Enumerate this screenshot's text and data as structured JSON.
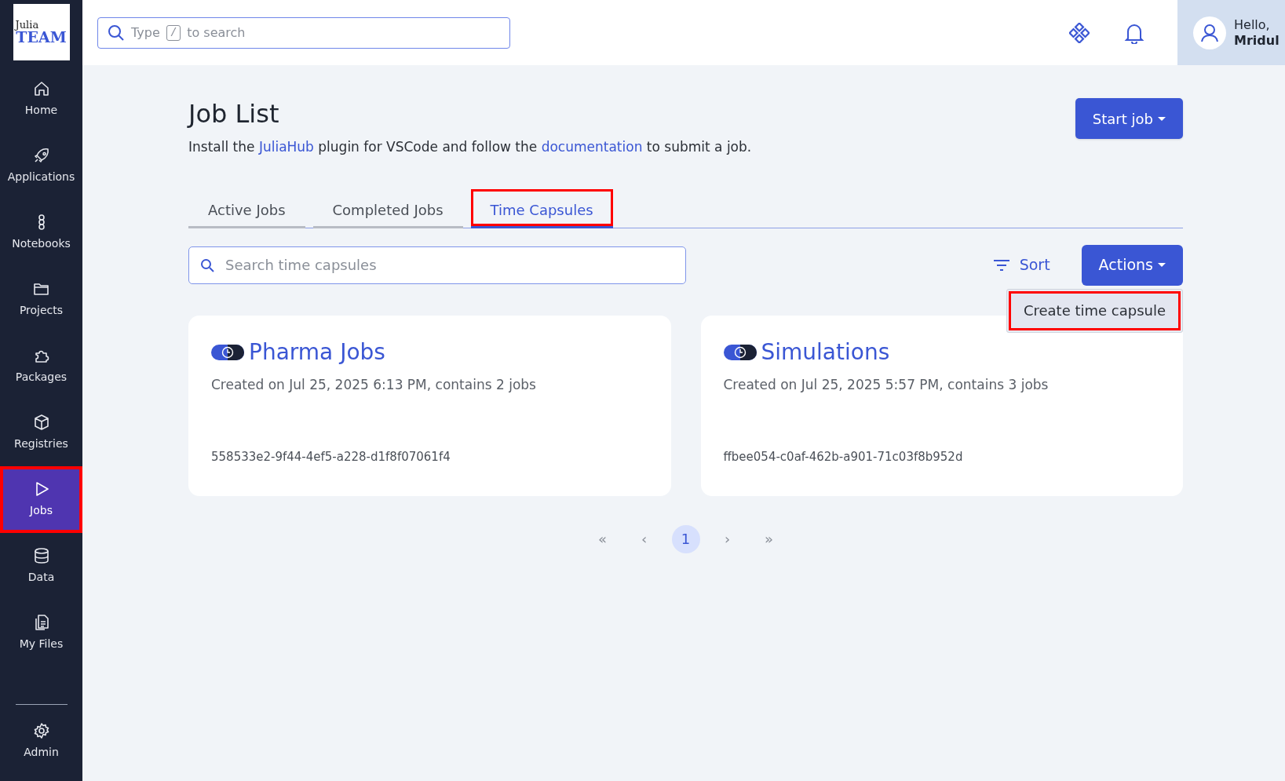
{
  "logo": {
    "line_1": "Julia",
    "line_2": "TEAM"
  },
  "sidebar": {
    "items": [
      {
        "label": "Home",
        "selected": false,
        "highlighted": false
      },
      {
        "label": "Applications",
        "selected": false,
        "highlighted": false
      },
      {
        "label": "Notebooks",
        "selected": false,
        "highlighted": false
      },
      {
        "label": "Projects",
        "selected": false,
        "highlighted": false
      },
      {
        "label": "Packages",
        "selected": false,
        "highlighted": false
      },
      {
        "label": "Registries",
        "selected": false,
        "highlighted": false
      },
      {
        "label": "Jobs",
        "selected": true,
        "highlighted": true
      },
      {
        "label": "Data",
        "selected": false,
        "highlighted": false
      },
      {
        "label": "My Files",
        "selected": false,
        "highlighted": false
      }
    ],
    "footer_item": {
      "label": "Admin",
      "selected": false
    }
  },
  "header": {
    "search": {
      "placeholder_before": "Type",
      "key": "/",
      "placeholder_after": "to search"
    },
    "greeting": "Hello,",
    "user": "Mridul"
  },
  "page": {
    "title": "Job List",
    "description": [
      {
        "kind": "text",
        "text": "Install the"
      },
      {
        "kind": "link",
        "text": "JuliaHub"
      },
      {
        "kind": "text",
        "text": "plugin for VSCode and follow the"
      },
      {
        "kind": "link",
        "text": "documentation"
      },
      {
        "kind": "text",
        "text": "to submit a job."
      }
    ],
    "start_button": "Start job"
  },
  "tabs": [
    {
      "label": "Active Jobs",
      "selected": false,
      "highlighted": false
    },
    {
      "label": "Completed Jobs",
      "selected": false,
      "highlighted": false
    },
    {
      "label": "Time Capsules",
      "selected": true,
      "highlighted": true
    }
  ],
  "toolbar": {
    "search": {
      "placeholder": "Search time capsules"
    },
    "sort": "Sort",
    "actions": "Actions",
    "menu": [
      {
        "label": "Create time capsule",
        "highlighted": true
      }
    ]
  },
  "capsules": [
    {
      "name": "Pharma Jobs",
      "info": "Created on Jul 25, 2025 6:13 PM, contains 2 jobs",
      "id": "558533e2-9f44-4ef5-a228-d1f8f07061f4"
    },
    {
      "name": "Simulations",
      "info": "Created on Jul 25, 2025 5:57 PM, contains 3 jobs",
      "id": "ffbee054-c0af-462b-a901-71c03f8b952d"
    }
  ],
  "pagination": [
    {
      "label": "«",
      "selected": false
    },
    {
      "label": "‹",
      "selected": false
    },
    {
      "label": "1",
      "selected": true
    },
    {
      "label": "›",
      "selected": false
    },
    {
      "label": "»",
      "selected": false
    }
  ]
}
